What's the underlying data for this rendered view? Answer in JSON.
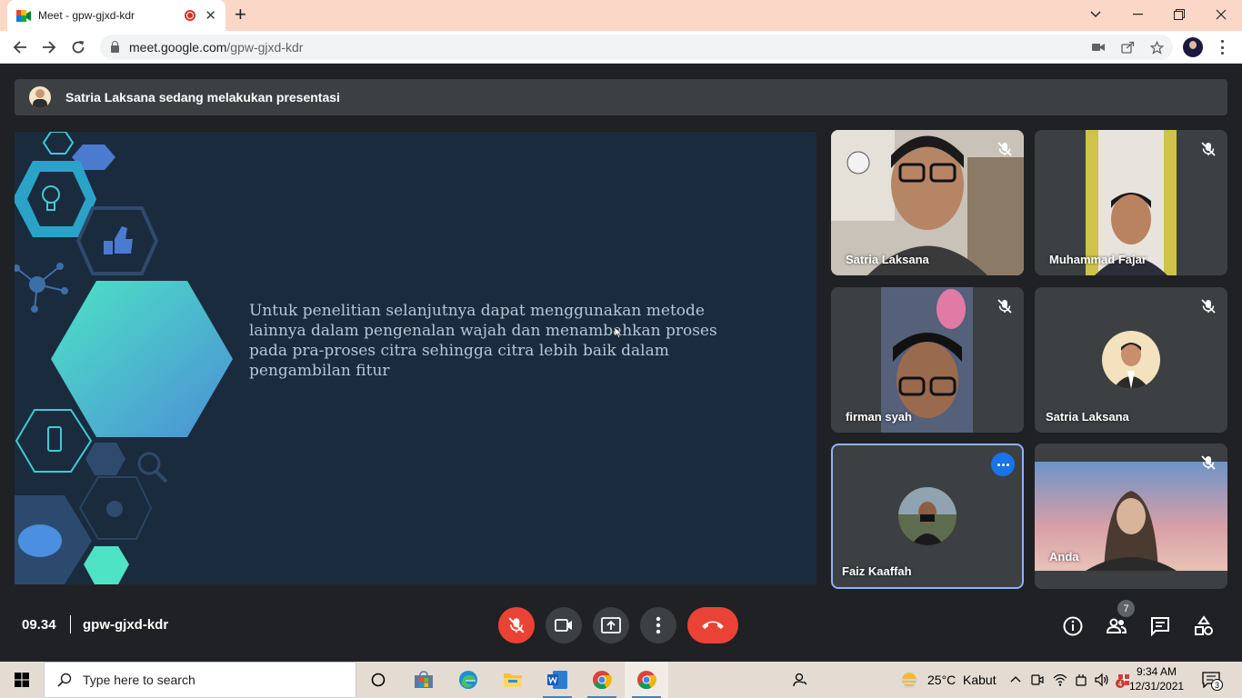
{
  "browser": {
    "tab_title": "Meet - gpw-gjxd-kdr",
    "tab_close": "✕",
    "new_tab": "+",
    "url_host": "meet.google.com",
    "url_path": "/gpw-gjxd-kdr",
    "window_controls": [
      "⌄",
      "—",
      "❐",
      "✕"
    ]
  },
  "meet": {
    "presenter_banner": "Satria Laksana sedang melakukan presentasi",
    "slide_text": "Untuk penelitian selanjutnya dapat menggunakan metode lainnya dalam pengenalan wajah dan menambahkan proses pada pra-proses citra sehingga citra lebih baik dalam pengambilan fitur",
    "participants": [
      {
        "name": "Satria Laksana",
        "muted": true,
        "video": true
      },
      {
        "name": "Muhammad Fajar",
        "muted": true,
        "video": true
      },
      {
        "name": "firman syah",
        "muted": true,
        "video": true
      },
      {
        "name": "Satria Laksana",
        "muted": true,
        "video": false
      },
      {
        "name": "Faiz Kaaffah",
        "muted": false,
        "video": false,
        "active_speaker": true
      },
      {
        "name": "Anda",
        "muted": true,
        "video": true
      }
    ],
    "meeting_time": "09.34",
    "meeting_code": "gpw-gjxd-kdr",
    "participant_count": "7",
    "colors": {
      "background": "#202124",
      "tile": "#3c4043",
      "danger": "#ea4335",
      "accent": "#8ab4f8"
    }
  },
  "taskbar": {
    "search_placeholder": "Type here to search",
    "weather_temp": "25°C",
    "weather_desc": "Kabut",
    "time": "9:34 AM",
    "date": "12/31/2021",
    "notification_count": "3",
    "tray_badge": "4",
    "apps": [
      "cortana-icon",
      "store-icon",
      "edge-icon",
      "file-explorer-icon",
      "word-icon",
      "chrome-icon",
      "chrome-icon"
    ]
  }
}
